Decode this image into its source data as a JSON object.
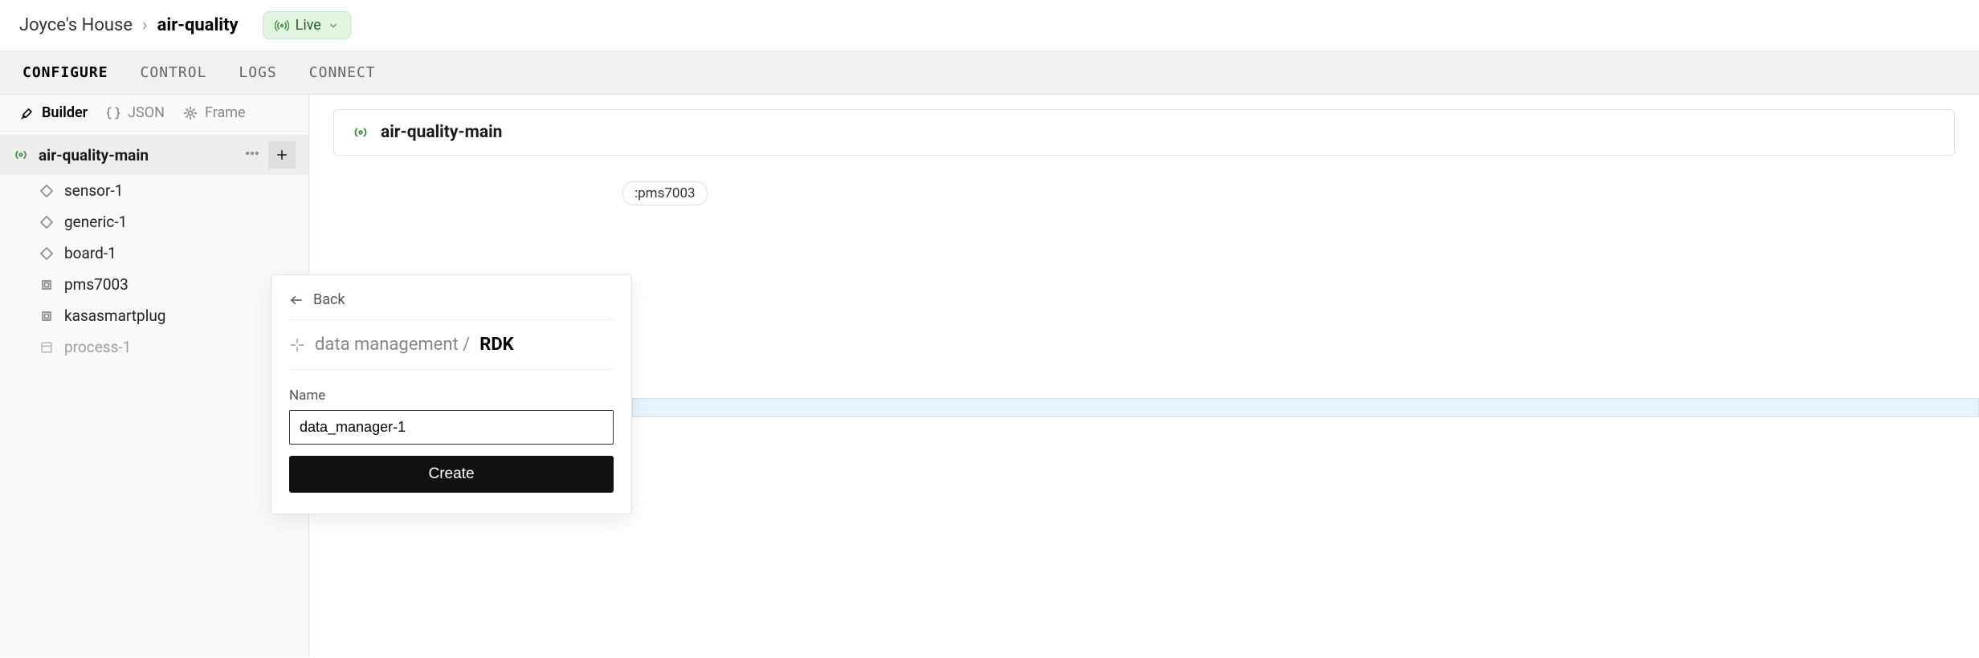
{
  "breadcrumb": {
    "root": "Joyce's House",
    "current": "air-quality"
  },
  "status": {
    "label": "Live"
  },
  "tabs": {
    "configure": "CONFIGURE",
    "control": "CONTROL",
    "logs": "LOGS",
    "connect": "CONNECT"
  },
  "sidebar": {
    "views": {
      "builder": "Builder",
      "json": "JSON",
      "frame": "Frame"
    },
    "root": {
      "label": "air-quality-main"
    },
    "items": [
      {
        "label": "sensor-1",
        "icon": "diamond"
      },
      {
        "label": "generic-1",
        "icon": "diamond"
      },
      {
        "label": "board-1",
        "icon": "diamond"
      },
      {
        "label": "pms7003",
        "icon": "chip"
      },
      {
        "label": "kasasmartplug",
        "icon": "chip"
      },
      {
        "label": "process-1",
        "icon": "process",
        "dim": true
      }
    ]
  },
  "main": {
    "title": "air-quality-main",
    "tag": ":pms7003"
  },
  "popover": {
    "back": "Back",
    "path_prefix": "data management /",
    "path_strong": "RDK",
    "name_label": "Name",
    "name_value": "data_manager-1",
    "create": "Create"
  }
}
